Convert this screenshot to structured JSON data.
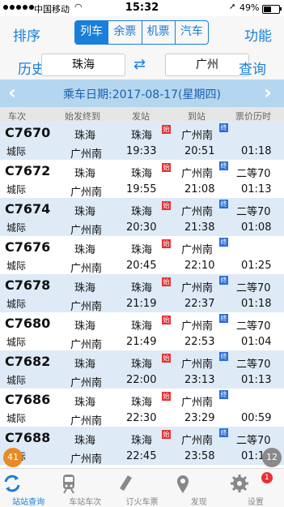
{
  "status": {
    "carrier": "中国移动",
    "time": "15:32",
    "battery": "49%"
  },
  "nav": {
    "left": "排序",
    "right": "功能",
    "tabs": [
      "列车",
      "余票",
      "机票",
      "汽车"
    ]
  },
  "route": {
    "history": "历史",
    "from": "珠海",
    "to": "广州",
    "query": "查询"
  },
  "date": {
    "text": "乘车日期:2017-08-17(星期四)"
  },
  "thead": [
    "车次",
    "始发终到",
    "发站",
    "到站",
    "票价历时"
  ],
  "rows": [
    {
      "code": "C7670",
      "kind": "城际",
      "origin": "珠海",
      "dest": "广州南",
      "from": "珠海",
      "dep": "19:33",
      "to": "广州南",
      "arr": "20:51",
      "price": "",
      "dur": "01:18",
      "alt": true
    },
    {
      "code": "C7672",
      "kind": "城际",
      "origin": "珠海",
      "dest": "广州南",
      "from": "珠海",
      "dep": "19:55",
      "to": "广州南",
      "arr": "21:08",
      "price": "二等70",
      "dur": "01:13",
      "alt": false
    },
    {
      "code": "C7674",
      "kind": "城际",
      "origin": "珠海",
      "dest": "广州南",
      "from": "珠海",
      "dep": "20:30",
      "to": "广州南",
      "arr": "21:38",
      "price": "二等70",
      "dur": "01:08",
      "alt": true
    },
    {
      "code": "C7676",
      "kind": "城际",
      "origin": "珠海",
      "dest": "广州南",
      "from": "珠海",
      "dep": "20:45",
      "to": "广州南",
      "arr": "22:10",
      "price": "",
      "dur": "01:25",
      "alt": false
    },
    {
      "code": "C7678",
      "kind": "城际",
      "origin": "珠海",
      "dest": "广州南",
      "from": "珠海",
      "dep": "21:19",
      "to": "广州南",
      "arr": "22:37",
      "price": "二等70",
      "dur": "01:18",
      "alt": true
    },
    {
      "code": "C7680",
      "kind": "城际",
      "origin": "珠海",
      "dest": "广州南",
      "from": "珠海",
      "dep": "21:49",
      "to": "广州南",
      "arr": "22:53",
      "price": "二等70",
      "dur": "01:04",
      "alt": false
    },
    {
      "code": "C7682",
      "kind": "城际",
      "origin": "珠海",
      "dest": "广州南",
      "from": "珠海",
      "dep": "22:00",
      "to": "广州南",
      "arr": "23:13",
      "price": "二等70",
      "dur": "01:13",
      "alt": true
    },
    {
      "code": "C7686",
      "kind": "城际",
      "origin": "珠海",
      "dest": "广州南",
      "from": "珠海",
      "dep": "22:30",
      "to": "广州南",
      "arr": "23:29",
      "price": "",
      "dur": "00:59",
      "alt": false
    },
    {
      "code": "C7688",
      "kind": "城际",
      "origin": "珠海",
      "dest": "广州南",
      "from": "珠海",
      "dep": "22:45",
      "to": "广州南",
      "arr": "23:58",
      "price": "二等70",
      "dur": "01:13",
      "alt": true
    }
  ],
  "badges": {
    "start": "始",
    "end": "终"
  },
  "floats": {
    "left": "41",
    "right": "12"
  },
  "tabbar": [
    {
      "label": "站站查询",
      "icon": "refresh-arrows-icon",
      "active": true
    },
    {
      "label": "车站车次",
      "icon": "train-icon",
      "active": false
    },
    {
      "label": "订火车票",
      "icon": "ticket-icon",
      "active": false
    },
    {
      "label": "发现",
      "icon": "location-pin-icon",
      "active": false
    },
    {
      "label": "设置",
      "icon": "gear-icon",
      "active": false,
      "badge": "1"
    }
  ]
}
